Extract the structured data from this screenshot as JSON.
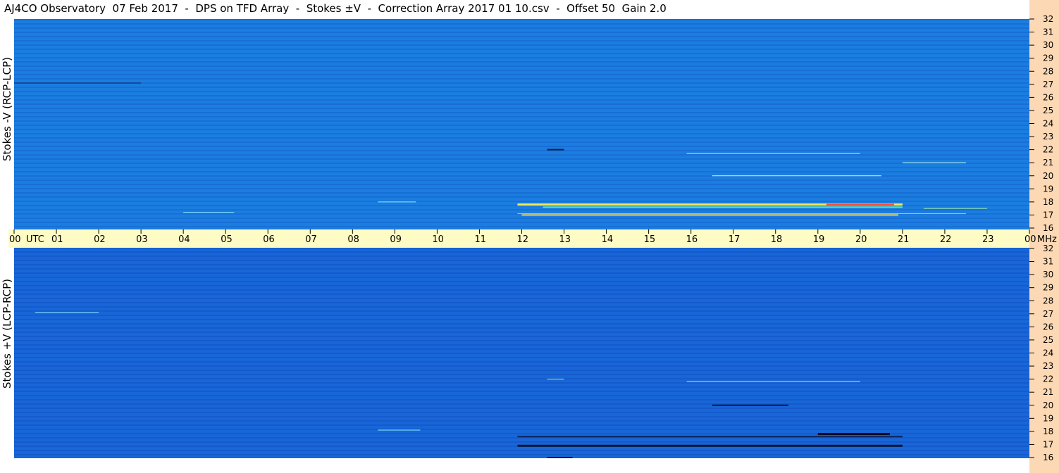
{
  "title": "AJ4CO Observatory  07 Feb 2017  -  DPS on TFD Array  -  Stokes ±V  -  Correction Array 2017 01 10.csv  -  Offset 50  Gain 2.0",
  "colors": {
    "spectrogram_top": "#1b7de0",
    "spectrogram_bottom": "#1866d8",
    "time_axis_band": "#fffbc4",
    "freq_axis_band": "#fcd9b4"
  },
  "chart_data": [
    {
      "type": "heatmap",
      "panel": "top",
      "ylabel": "Stokes -V (RCP-LCP)",
      "y_unit": "MHz",
      "ylim": [
        16,
        32
      ],
      "y_ticks": [
        "32",
        "31",
        "30",
        "29",
        "28",
        "27",
        "26",
        "25",
        "24",
        "23",
        "22",
        "21",
        "20",
        "19",
        "18",
        "17",
        "16"
      ],
      "x_ticks": [
        "00",
        "01",
        "02",
        "03",
        "04",
        "05",
        "06",
        "07",
        "08",
        "09",
        "10",
        "11",
        "12",
        "13",
        "14",
        "15",
        "16",
        "17",
        "18",
        "19",
        "20",
        "21",
        "22",
        "23",
        "00"
      ],
      "x_unit": "UTC",
      "xlim": [
        0,
        24
      ]
    },
    {
      "type": "heatmap",
      "panel": "bottom",
      "ylabel": "Stokes +V (LCP-RCP)",
      "y_unit": "MHz",
      "ylim": [
        16,
        32
      ],
      "y_ticks": [
        "32",
        "31",
        "30",
        "29",
        "28",
        "27",
        "26",
        "25",
        "24",
        "23",
        "22",
        "21",
        "20",
        "19",
        "18",
        "17",
        "16"
      ],
      "x_ticks": [
        "00",
        "01",
        "02",
        "03",
        "04",
        "05",
        "06",
        "07",
        "08",
        "09",
        "10",
        "11",
        "12",
        "13",
        "14",
        "15",
        "16",
        "17",
        "18",
        "19",
        "20",
        "21",
        "22",
        "23",
        "00"
      ],
      "x_unit": "UTC",
      "xlim": [
        0,
        24
      ]
    }
  ],
  "time_axis": {
    "hours": [
      "00",
      "01",
      "02",
      "03",
      "04",
      "05",
      "06",
      "07",
      "08",
      "09",
      "10",
      "11",
      "12",
      "13",
      "14",
      "15",
      "16",
      "17",
      "18",
      "19",
      "20",
      "21",
      "22",
      "23",
      "00"
    ],
    "utc_label": "UTC",
    "mhz_label": "MHz"
  }
}
